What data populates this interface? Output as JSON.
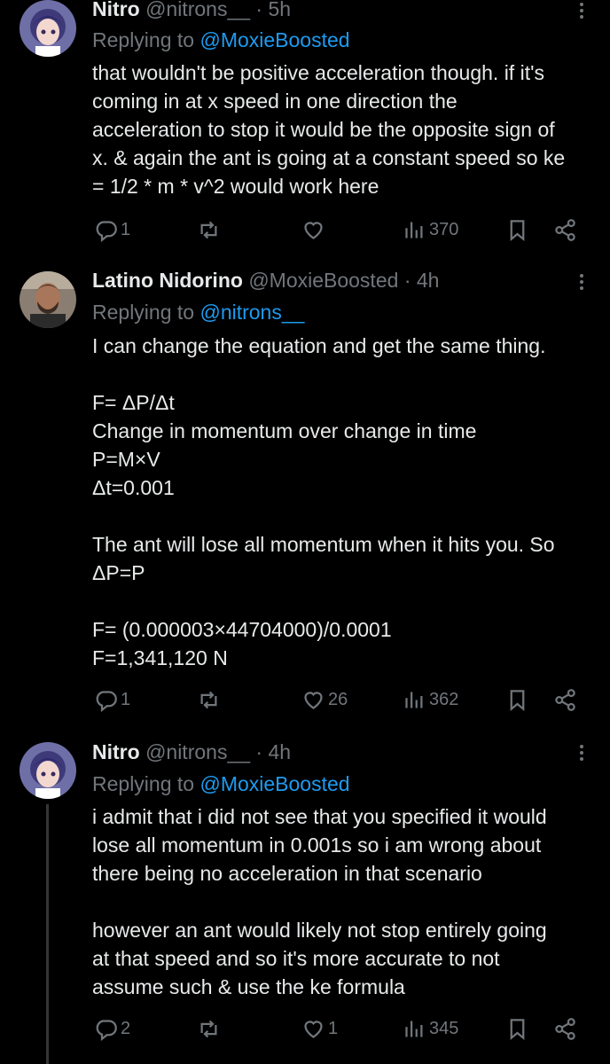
{
  "tweets": [
    {
      "name": "Nitro",
      "handle": "@nitrons__",
      "dot": "·",
      "time": "5h",
      "replying_prefix": "Replying to ",
      "replying_to": "@MoxieBoosted",
      "text": "that wouldn't be positive acceleration though. if it's\ncoming in at x speed in one direction the\nacceleration to stop it would be the opposite sign of\nx. & again the ant is going at a constant speed so ke\n= 1/2 * m * v^2 would work here",
      "replies": "1",
      "retweets": "",
      "likes": "",
      "views": "370"
    },
    {
      "name": "Latino Nidorino",
      "handle": "@MoxieBoosted",
      "dot": "·",
      "time": "4h",
      "replying_prefix": "Replying to ",
      "replying_to": "@nitrons__",
      "text": "I can change the equation and get the same thing.\n\nF= ΔP/Δt\nChange in momentum over change in time\nP=M×V\nΔt=0.001\n\nThe ant will lose all momentum when it hits you. So\nΔP=P\n\nF= (0.000003×44704000)/0.0001\nF=1,341,120 N",
      "replies": "1",
      "retweets": "",
      "likes": "26",
      "views": "362"
    },
    {
      "name": "Nitro",
      "handle": "@nitrons__",
      "dot": "·",
      "time": "4h",
      "replying_prefix": "Replying to ",
      "replying_to": "@MoxieBoosted",
      "text": "i admit that i did not see that you specified it would\nlose all momentum in 0.001s so i am wrong about\nthere being no acceleration in that scenario\n\nhowever an ant would likely not stop entirely going\nat that speed and so it's more accurate to not\nassume such & use the ke formula",
      "replies": "2",
      "retweets": "",
      "likes": "1",
      "views": "345"
    }
  ],
  "icons": {
    "reply": "reply-icon",
    "retweet": "retweet-icon",
    "like": "heart-icon",
    "views": "views-icon",
    "bookmark": "bookmark-icon",
    "share": "share-icon",
    "more": "more-icon"
  },
  "colors": {
    "background": "#000000",
    "text": "#e7e9ea",
    "muted": "#71767b",
    "link": "#1d9bf0"
  }
}
